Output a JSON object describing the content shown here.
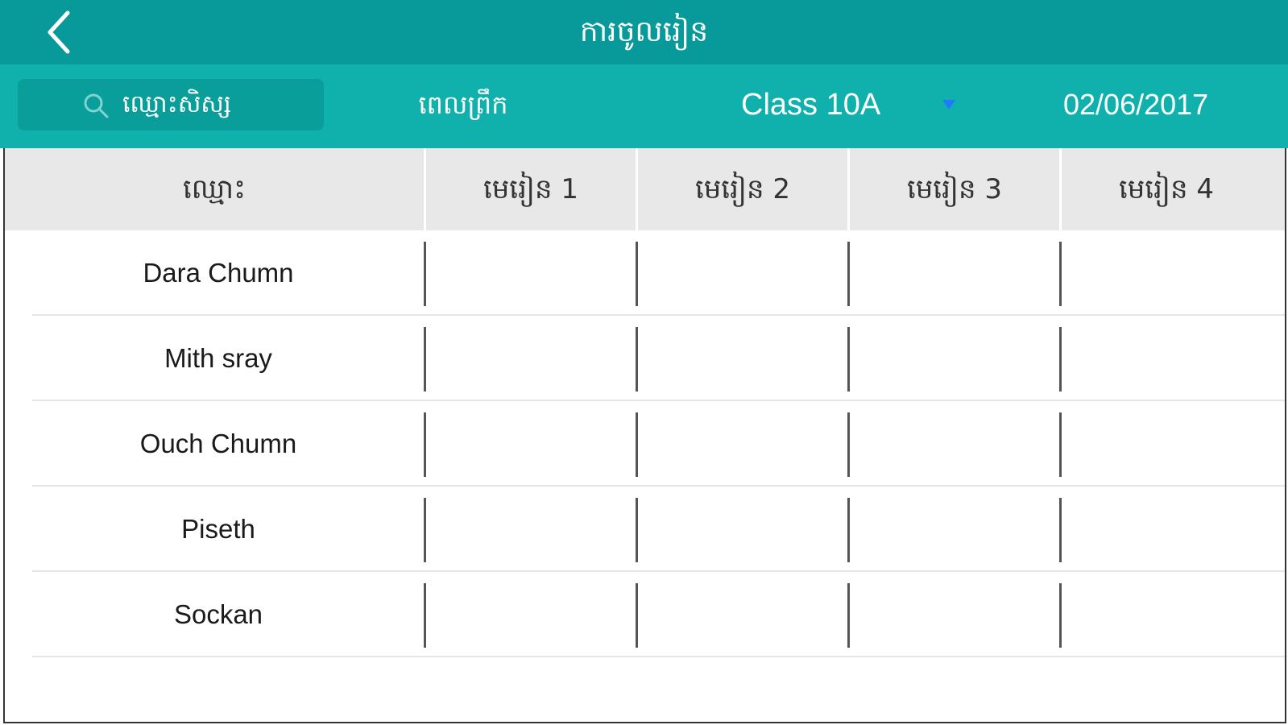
{
  "header": {
    "title": "ការចូលរៀន",
    "back_icon": "chevron-left-icon"
  },
  "filters": {
    "search_placeholder": "ឈ្មោះសិស្ស",
    "search_icon": "search-icon",
    "session": "ពេលព្រឹក",
    "class_value": "Class 10A",
    "class_dropdown_icon": "triangle-down-icon",
    "date": "02/06/2017"
  },
  "colors": {
    "title_bar": "#089a9a",
    "filter_bar": "#10b0ad",
    "search_box": "#0a9e9b",
    "dropdown_arrow": "#1e7bff",
    "header_row": "#e8e8e8"
  },
  "table": {
    "columns": [
      "ឈ្មោះ",
      "មេរៀន 1",
      "មេរៀន 2",
      "មេរៀន 3",
      "មេរៀន 4"
    ],
    "rows": [
      {
        "name": "Dara Chumn"
      },
      {
        "name": "Mith sray"
      },
      {
        "name": "Ouch Chumn"
      },
      {
        "name": "Piseth"
      },
      {
        "name": "Sockan"
      }
    ]
  }
}
